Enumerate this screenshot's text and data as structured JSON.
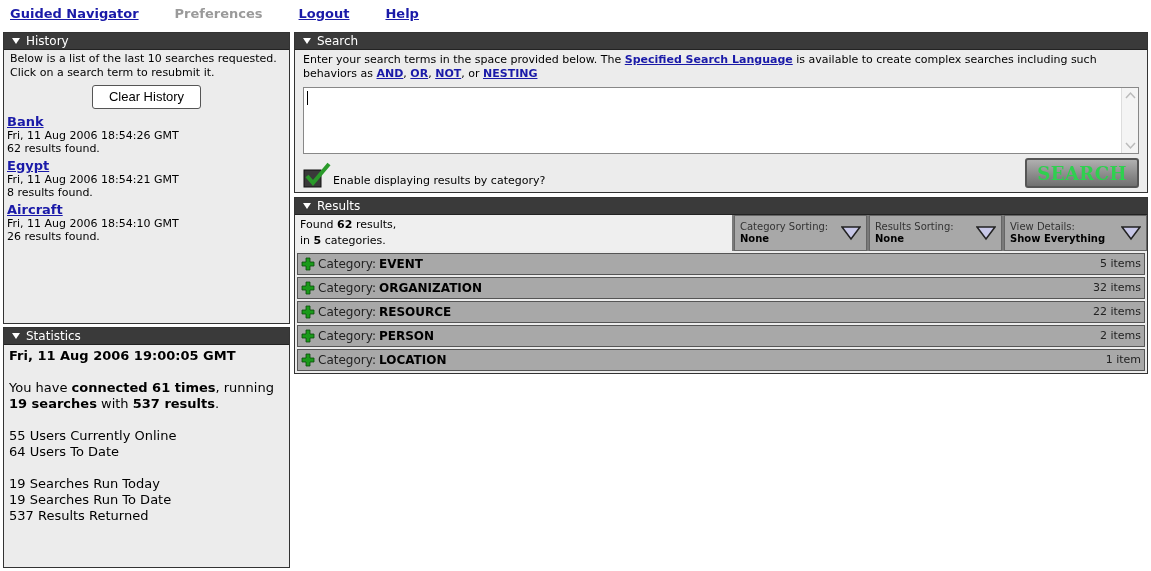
{
  "nav": [
    {
      "label": "Guided Navigator",
      "selected": false
    },
    {
      "label": "Preferences",
      "selected": true
    },
    {
      "label": "Logout",
      "selected": false
    },
    {
      "label": "Help",
      "selected": false
    }
  ],
  "history": {
    "title": "History",
    "intro": "Below is a list of the last 10 searches requested. Click on a search term to resubmit it.",
    "clear_button": "Clear History",
    "items": [
      {
        "term": "Bank",
        "time": "Fri, 11 Aug 2006 18:54:26 GMT",
        "results": "62 results found."
      },
      {
        "term": "Egypt",
        "time": "Fri, 11 Aug 2006 18:54:21 GMT",
        "results": "8 results found."
      },
      {
        "term": "Aircraft",
        "time": "Fri, 11 Aug 2006 18:54:10 GMT",
        "results": "26 results found."
      }
    ]
  },
  "statistics": {
    "title": "Statistics",
    "date": "Fri, 11 Aug 2006 19:00:05 GMT",
    "summary": "You have **connected 61 times**, running **19 searches** with **537 results**.",
    "groups": [
      [
        "55 Users Currently Online",
        "64 Users To Date"
      ],
      [
        "19 Searches Run Today",
        "19 Searches Run To Date",
        "537 Results Returned"
      ]
    ]
  },
  "search": {
    "title": "Search",
    "intro": [
      {
        "kind": "text",
        "text": "Enter your search terms in the space provided below.  The"
      },
      {
        "kind": "link",
        "text": "Specified Search Language"
      },
      {
        "kind": "text",
        "text": "is available to create complex searches including such behaviors as"
      },
      {
        "kind": "link",
        "text": "AND"
      },
      {
        "kind": "text",
        "text": ","
      },
      {
        "kind": "link",
        "text": "OR"
      },
      {
        "kind": "text",
        "text": ","
      },
      {
        "kind": "link",
        "text": "NOT"
      },
      {
        "kind": "text",
        "text": ", or"
      },
      {
        "kind": "link",
        "text": "NESTING"
      }
    ],
    "category_checkbox": {
      "label": "Enable displaying results by category?",
      "checked": true
    },
    "button": "SEARCH"
  },
  "results": {
    "title": "Results",
    "summary": [
      "Found **62** results,",
      "in **5** categories."
    ],
    "dropdowns": [
      {
        "label": "Category Sorting:",
        "value": "None"
      },
      {
        "label": "Results Sorting:",
        "value": "None"
      },
      {
        "label": "View Details:",
        "value": "Show Everything"
      }
    ],
    "categories": [
      {
        "label": "Category:",
        "name": "EVENT",
        "count": "5 items",
        "expanded": false
      },
      {
        "label": "Category:",
        "name": "ORGANIZATION",
        "count": "32 items",
        "expanded": false
      },
      {
        "label": "Category:",
        "name": "RESOURCE",
        "count": "22 items",
        "expanded": false
      },
      {
        "label": "Category:",
        "name": "PERSON",
        "count": "2 items",
        "expanded": false
      },
      {
        "label": "Category:",
        "name": "LOCATION",
        "count": "1 item",
        "expanded": false
      }
    ]
  }
}
